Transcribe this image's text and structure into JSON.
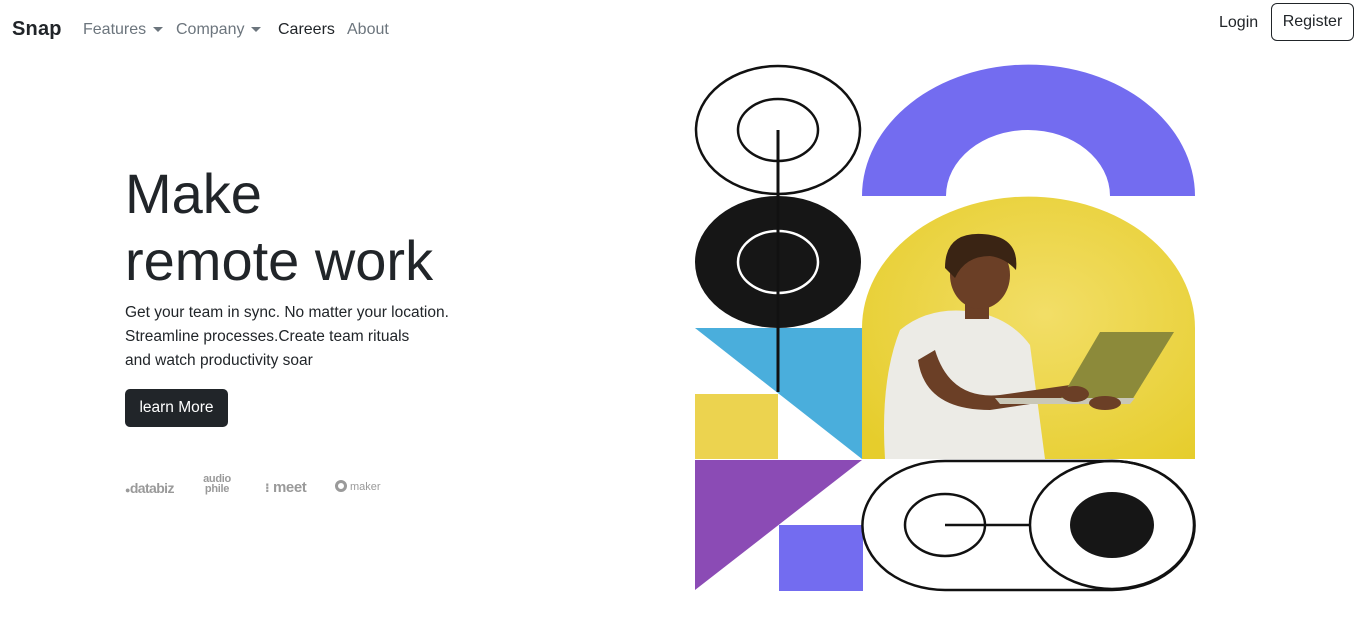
{
  "nav": {
    "brand": "Snap",
    "items": [
      {
        "label": "Features",
        "dropdown": true
      },
      {
        "label": "Company",
        "dropdown": true
      },
      {
        "label": "Careers",
        "dropdown": false
      },
      {
        "label": "About",
        "dropdown": false
      }
    ],
    "login_label": "Login",
    "register_label": "Register"
  },
  "hero": {
    "title_line1": "Make",
    "title_line2": "remote work",
    "text_line1": "Get your team in sync. No matter your location.",
    "text_line2": "Streamline processes.Create team rituals",
    "text_line3": "and watch productivity soar",
    "cta_label": "learn More"
  },
  "clients": {
    "databiz": "databiz",
    "audiophile_top": "audio",
    "audiophile_bottom": "phile",
    "meet": "meet",
    "maker": "maker"
  },
  "colors": {
    "dark": "#212529",
    "muted": "#6c757d",
    "purple": "#736cf0",
    "violet": "#8b4bb5",
    "blue": "#4aaedc",
    "yellow": "#ecd34f",
    "photo_bg": "#e7cf30"
  }
}
